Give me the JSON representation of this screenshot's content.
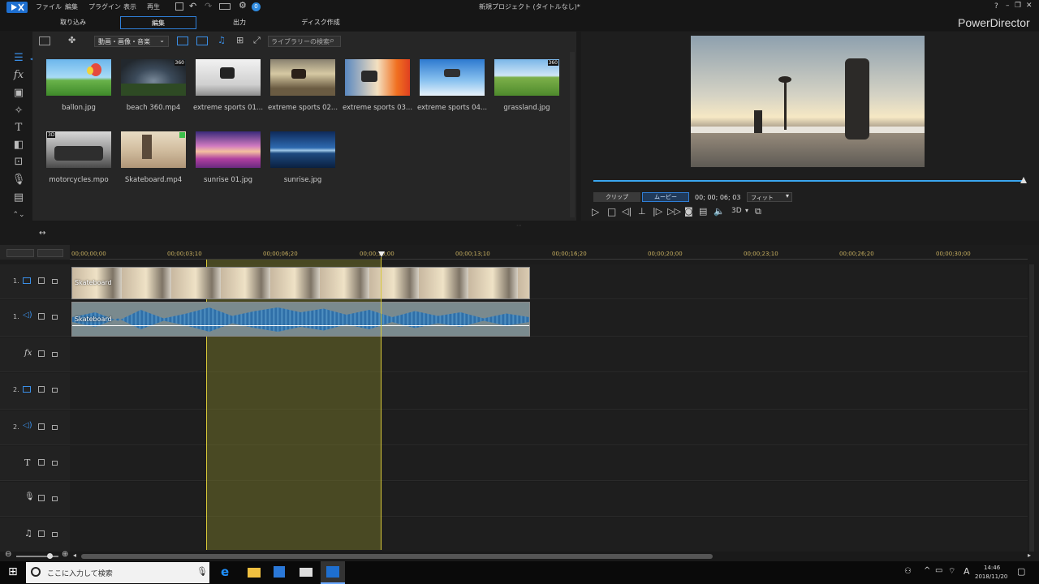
{
  "app": {
    "title": "新規プロジェクト (タイトルなし)*",
    "brand": "PowerDirector",
    "menus": [
      "ファイル",
      "編集",
      "プラグイン",
      "表示",
      "再生"
    ],
    "notif_count": "0",
    "help": "?"
  },
  "modes": [
    "取り込み",
    "編集",
    "出力",
    "ディスク作成"
  ],
  "library": {
    "filter": "動画・画像・音楽",
    "search_placeholder": "ライブラリーの検索",
    "items": [
      {
        "label": "ballon.jpg",
        "badge": ""
      },
      {
        "label": "beach 360.mp4",
        "badge": "360"
      },
      {
        "label": "extreme sports 01...",
        "badge": ""
      },
      {
        "label": "extreme sports 02...",
        "badge": ""
      },
      {
        "label": "extreme sports 03...",
        "badge": ""
      },
      {
        "label": "extreme sports 04...",
        "badge": ""
      },
      {
        "label": "grassland.jpg",
        "badge": "360"
      },
      {
        "label": "motorcycles.mpo",
        "badge": "3D"
      },
      {
        "label": "Skateboard.mp4",
        "badge": ""
      },
      {
        "label": "sunrise 01.jpg",
        "badge": ""
      },
      {
        "label": "sunrise.jpg",
        "badge": ""
      }
    ]
  },
  "preview": {
    "clip_tab": "クリップ",
    "movie_tab": "ムービー",
    "timecode": "00; 00; 06; 03",
    "fit": "フィット",
    "mode3d": "3D"
  },
  "timeline": {
    "ruler": [
      "00;00;00;00",
      "00;00;03;10",
      "00;00;06;20",
      "00;00;10;00",
      "00;00;13;10",
      "00;00;16;20",
      "00;00;20;00",
      "00;00;23;10",
      "00;00;26;20",
      "00;00;30;00"
    ],
    "tracks": [
      {
        "label": "1.",
        "kind": "video"
      },
      {
        "label": "1.",
        "kind": "audio"
      },
      {
        "label": "fx",
        "kind": "fx"
      },
      {
        "label": "2.",
        "kind": "video"
      },
      {
        "label": "2.",
        "kind": "audio"
      },
      {
        "label": "T",
        "kind": "title"
      },
      {
        "label": "",
        "kind": "voice"
      },
      {
        "label": "",
        "kind": "music"
      }
    ],
    "clip_label": "Skateboard"
  },
  "taskbar": {
    "search": "ここに入力して検索",
    "time": "14:46",
    "date": "2018/11/20",
    "ime": "A"
  }
}
